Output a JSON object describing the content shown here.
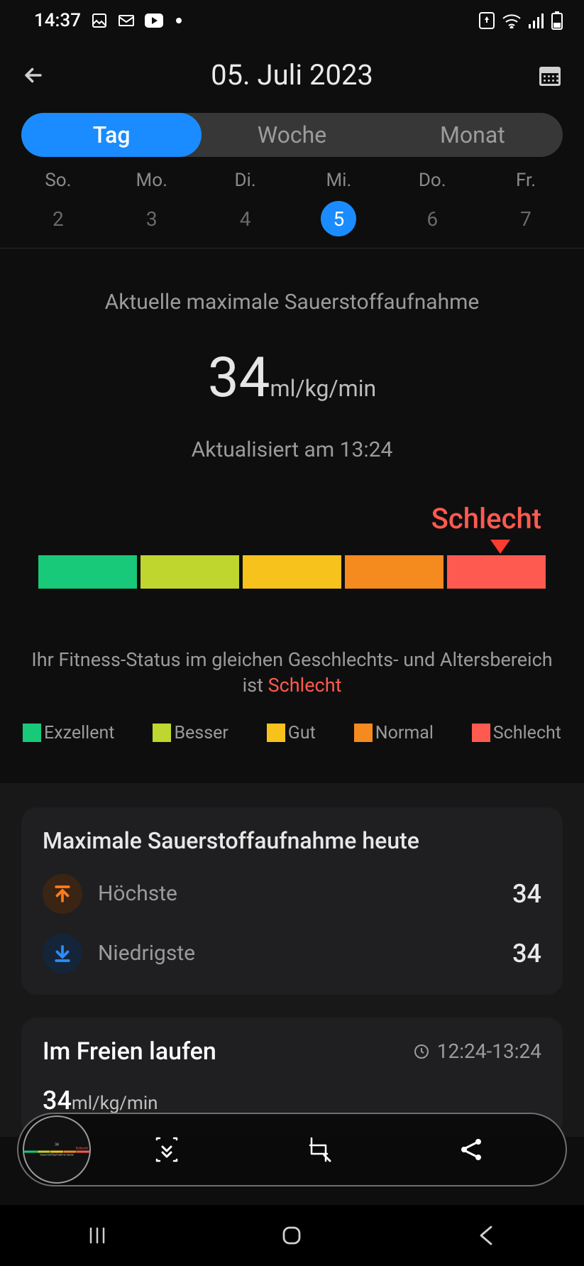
{
  "status_bar": {
    "time": "14:37"
  },
  "header": {
    "title": "05. Juli 2023"
  },
  "tabs": {
    "day": "Tag",
    "week": "Woche",
    "month": "Monat"
  },
  "days": [
    {
      "abbr": "So.",
      "num": "2"
    },
    {
      "abbr": "Mo.",
      "num": "3"
    },
    {
      "abbr": "Di.",
      "num": "4"
    },
    {
      "abbr": "Mi.",
      "num": "5"
    },
    {
      "abbr": "Do.",
      "num": "6"
    },
    {
      "abbr": "Fr.",
      "num": "7"
    }
  ],
  "vo2": {
    "title": "Aktuelle maximale Sauerstoffaufnahme",
    "value": "34",
    "unit": "ml/kg/min",
    "updated": "Aktualisiert am 13:24",
    "rating_label": "Schlecht",
    "status_prefix": "Ihr Fitness-Status im gleichen Geschlechts- und Altersbereich ist",
    "status_value": "Schlecht"
  },
  "legend": {
    "exc": "Exzellent",
    "better": "Besser",
    "gut": "Gut",
    "normal": "Normal",
    "schlecht": "Schlecht"
  },
  "today_card": {
    "title": "Maximale Sauerstoffaufnahme heute",
    "high_label": "Höchste",
    "high_value": "34",
    "low_label": "Niedrigste",
    "low_value": "34"
  },
  "activity": {
    "title": "Im Freien laufen",
    "time": "12:24-13:24",
    "value": "34",
    "unit": "ml/kg/min"
  }
}
